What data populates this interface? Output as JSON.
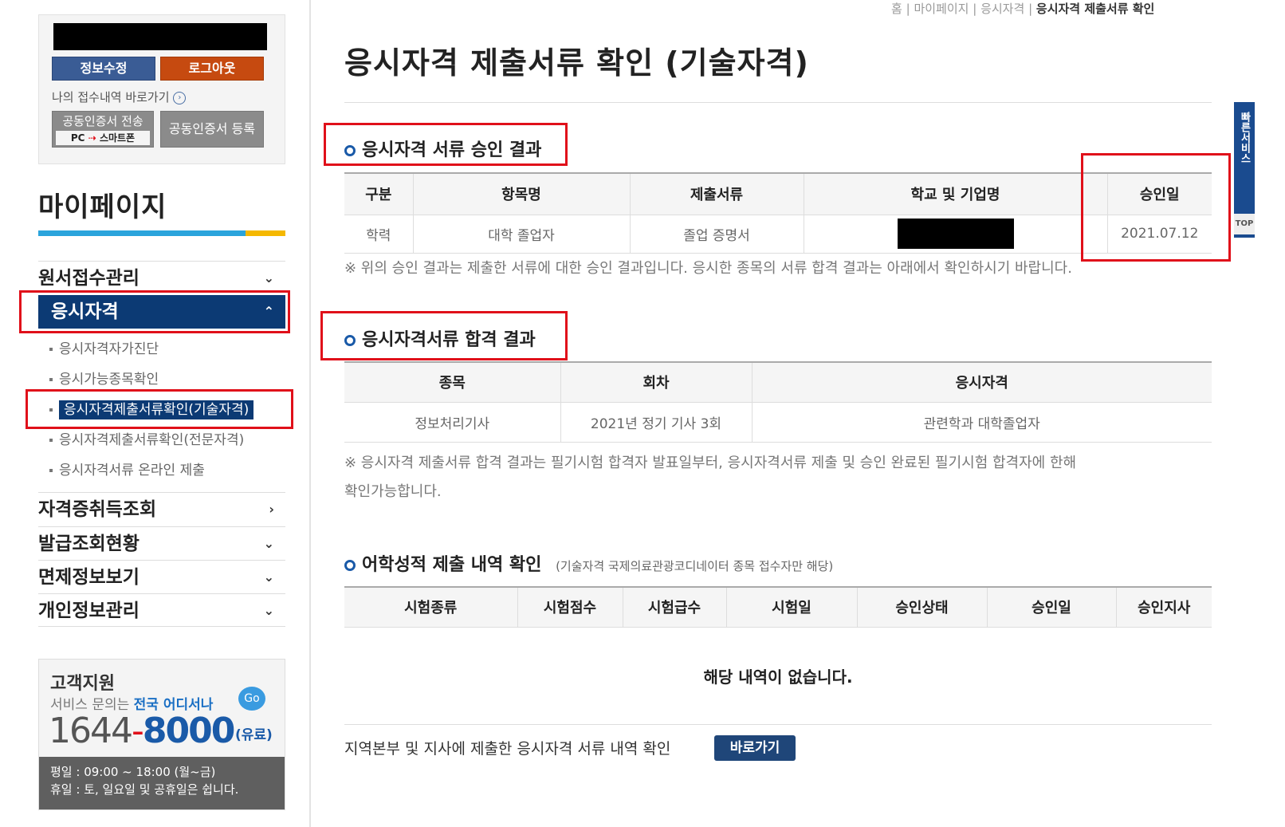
{
  "login": {
    "edit_info": "정보수정",
    "logout": "로그아웃",
    "shortcut": "나의 접수내역 바로가기",
    "cert_send_top": "공동인증서 전송",
    "cert_send_pc": "PC",
    "cert_send_phone": "스마트폰",
    "cert_register": "공동인증서 등록"
  },
  "sidebar": {
    "title": "마이페이지",
    "menu": [
      {
        "label": "원서접수관리",
        "chev": "⌄"
      },
      {
        "label": "응시자격",
        "chev": "⌃"
      },
      {
        "label": "자격증취득조회",
        "chev": "›"
      },
      {
        "label": "발급조회현황",
        "chev": "⌄"
      },
      {
        "label": "면제정보보기",
        "chev": "⌄"
      },
      {
        "label": "개인정보관리",
        "chev": "⌄"
      }
    ],
    "sub_items": [
      "응시자격자가진단",
      "응시가능종목확인",
      "응시자격제출서류확인(기술자격)",
      "응시자격제출서류확인(전문자격)",
      "응시자격서류 온라인 제출"
    ]
  },
  "support": {
    "title": "고객지원",
    "line_prefix": "서비스 문의는",
    "line_highlight": "전국 어디서나",
    "go": "Go",
    "phone_a": "1644",
    "phone_dash": "-",
    "phone_b": "8000",
    "paid": "(유료)",
    "hours1": "평일 : 09:00 ~ 18:00 (월~금)",
    "hours2": "휴일 : 토, 일요일 및 공휴일은 쉽니다."
  },
  "breadcrumb": {
    "home": "홈",
    "sep": "|",
    "mypage": "마이페이지",
    "qual": "응시자격",
    "current": "응시자격 제출서류 확인"
  },
  "page_title": "응시자격 제출서류 확인 (기술자격)",
  "section1": {
    "title": "응시자격 서류 승인 결과",
    "headers": [
      "구분",
      "항목명",
      "제출서류",
      "학교 및 기업명",
      "승인일"
    ],
    "row": [
      "학력",
      "대학 졸업자",
      "졸업 증명서",
      "",
      "2021.07.12"
    ],
    "note": "※ 위의 승인 결과는 제출한 서류에 대한 승인 결과입니다. 응시한 종목의 서류 합격 결과는 아래에서 확인하시기 바랍니다."
  },
  "section2": {
    "title": "응시자격서류 합격 결과",
    "headers": [
      "종목",
      "회차",
      "응시자격"
    ],
    "row": [
      "정보처리기사",
      "2021년 정기 기사 3회",
      "관련학과 대학졸업자"
    ],
    "note1": "※ 응시자격 제출서류 합격 결과는 필기시험 합격자 발표일부터, 응시자격서류 제출 및 승인 완료된 필기시험 합격자에 한해",
    "note2": "확인가능합니다."
  },
  "section3": {
    "title": "어학성적 제출 내역 확인",
    "subtitle": "(기술자격 국제의료관광코디네이터 종목 접수자만 해당)",
    "headers": [
      "시험종류",
      "시험점수",
      "시험급수",
      "시험일",
      "승인상태",
      "승인일",
      "승인지사"
    ],
    "empty": "해당 내역이 없습니다."
  },
  "bottom": {
    "text": "지역본부 및 지사에 제출한 응시자격 서류 내역 확인",
    "button": "바로가기"
  },
  "quick": {
    "label": "빠른서비스",
    "top": "TOP"
  }
}
